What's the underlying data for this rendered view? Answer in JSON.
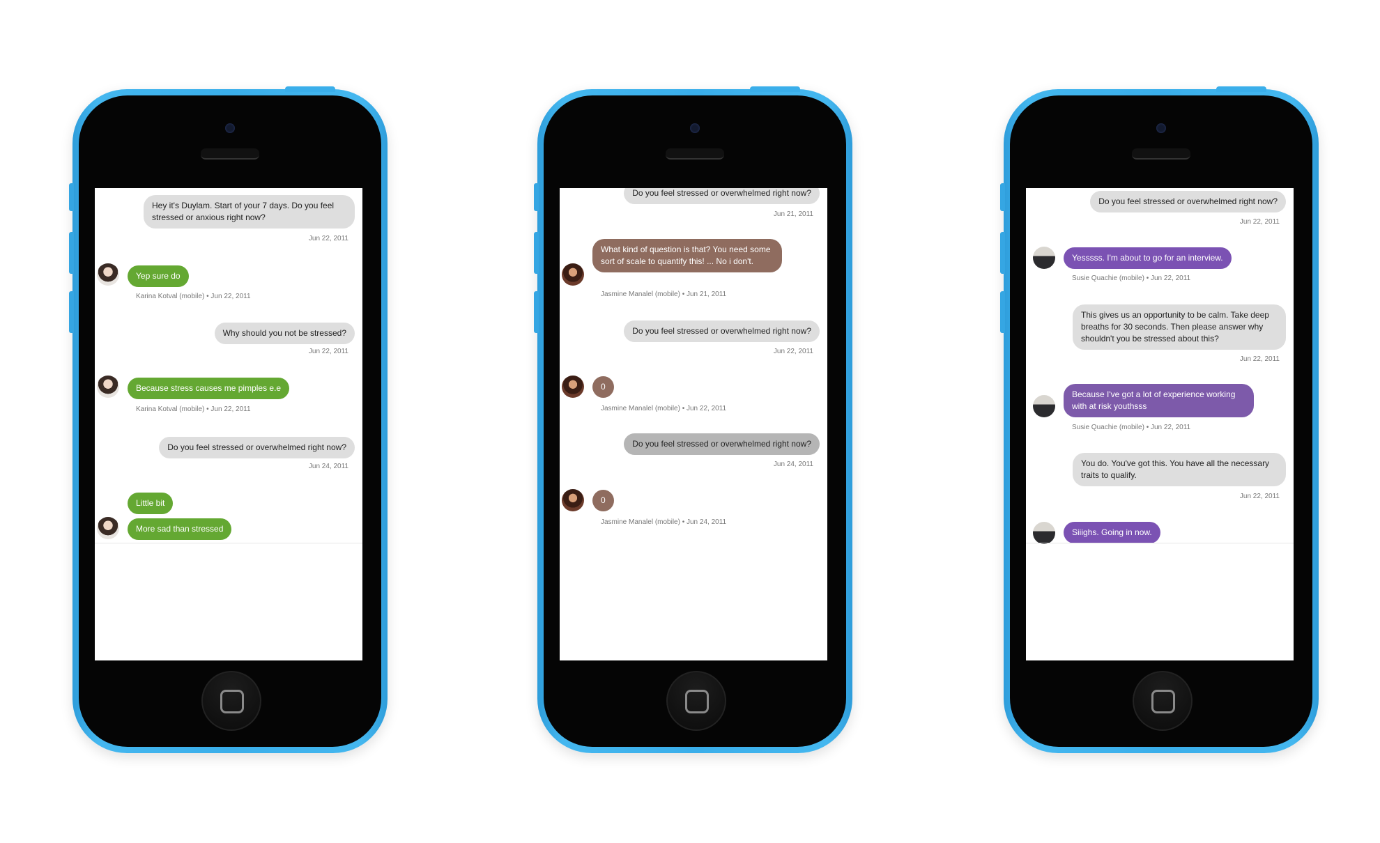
{
  "phones": [
    {
      "messages": {
        "m1": {
          "text": "Hey it's Duylam. Start of your 7 days. Do you feel stressed or anxious right now?",
          "meta": "Jun 22, 2011"
        },
        "m2": {
          "text": "Yep sure do",
          "meta": "Karina Kotval (mobile) • Jun 22, 2011"
        },
        "m3": {
          "text": "Why should you not be stressed?",
          "meta": "Jun 22, 2011"
        },
        "m4": {
          "text": "Because stress causes me pimples e.e",
          "meta": "Karina Kotval (mobile) • Jun 22, 2011"
        },
        "m5": {
          "text": "Do you feel stressed or overwhelmed right now?",
          "meta": "Jun 24, 2011"
        },
        "m6": {
          "text": "Little bit"
        },
        "m7": {
          "text": "More sad than stressed"
        }
      }
    },
    {
      "messages": {
        "m1": {
          "text": "Do you feel stressed or overwhelmed right now?",
          "meta": "Jun 21, 2011"
        },
        "m2": {
          "text": "What kind of question is that? You need some sort of scale to quantify this! ... No i don't.",
          "meta": "Jasmine Manalel (mobile) • Jun 21, 2011"
        },
        "m3": {
          "text": "Do you feel stressed or overwhelmed right now?",
          "meta": "Jun 22, 2011"
        },
        "m4": {
          "text": "0",
          "meta": "Jasmine Manalel (mobile) • Jun 22, 2011"
        },
        "m5": {
          "text": "Do you feel stressed or overwhelmed right now?",
          "meta": "Jun 24, 2011"
        },
        "m6": {
          "text": "0",
          "meta": "Jasmine Manalel (mobile) • Jun 24, 2011"
        }
      }
    },
    {
      "messages": {
        "m1": {
          "text": "Do you feel stressed or overwhelmed right now?",
          "meta": "Jun 22, 2011"
        },
        "m2": {
          "text": "Yesssss.  I'm about to go for an interview.",
          "meta": "Susie Quachie (mobile) • Jun 22, 2011"
        },
        "m3": {
          "text": "This gives us an opportunity to be calm. Take deep breaths for 30 seconds. Then please answer why shouldn't you be stressed about this?",
          "meta": "Jun 22, 2011"
        },
        "m4": {
          "text": "Because I've got a lot of experience working with at risk youthsss",
          "meta": "Susie Quachie (mobile) • Jun 22, 2011"
        },
        "m5": {
          "text": "You do. You've got this. You have all the necessary traits to qualify.",
          "meta": "Jun 22, 2011"
        },
        "m6": {
          "text": "Siiighs.  Going in now."
        }
      }
    }
  ],
  "colors": {
    "phone_body": "#3aaeea",
    "outgoing_bubble": "#dedede",
    "green_bubble": "#64a832",
    "brown_bubble": "#8f6c5f",
    "purple_bubble": "#7b52b3"
  }
}
